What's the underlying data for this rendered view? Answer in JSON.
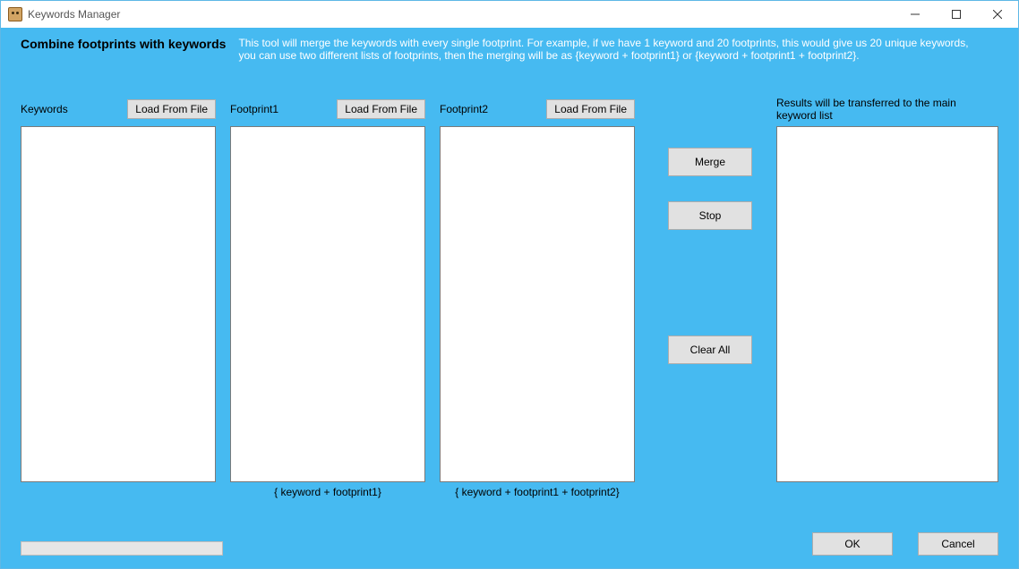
{
  "window": {
    "title": "Keywords Manager"
  },
  "header": {
    "title": "Combine footprints with keywords",
    "description": "This tool will merge the keywords with every single footprint. For example, if we have 1 keyword and 20 footprints, this would give us 20 unique keywords, you can use two different lists of footprints, then the merging will be as {keyword + footprint1} or {keyword + footprint1 + footprint2}."
  },
  "columns": {
    "keywords": {
      "label": "Keywords",
      "load_button": "Load From File",
      "value": "",
      "foot": ""
    },
    "footprint1": {
      "label": "Footprint1",
      "load_button": "Load From File",
      "value": "",
      "foot": "{ keyword + footprint1}"
    },
    "footprint2": {
      "label": "Footprint2",
      "load_button": "Load From File",
      "value": "",
      "foot": "{ keyword + footprint1 + footprint2}"
    },
    "results": {
      "label": "Results will be transferred to the main keyword list",
      "value": ""
    }
  },
  "actions": {
    "merge": "Merge",
    "stop": "Stop",
    "clear_all": "Clear All"
  },
  "dialog": {
    "ok": "OK",
    "cancel": "Cancel"
  }
}
